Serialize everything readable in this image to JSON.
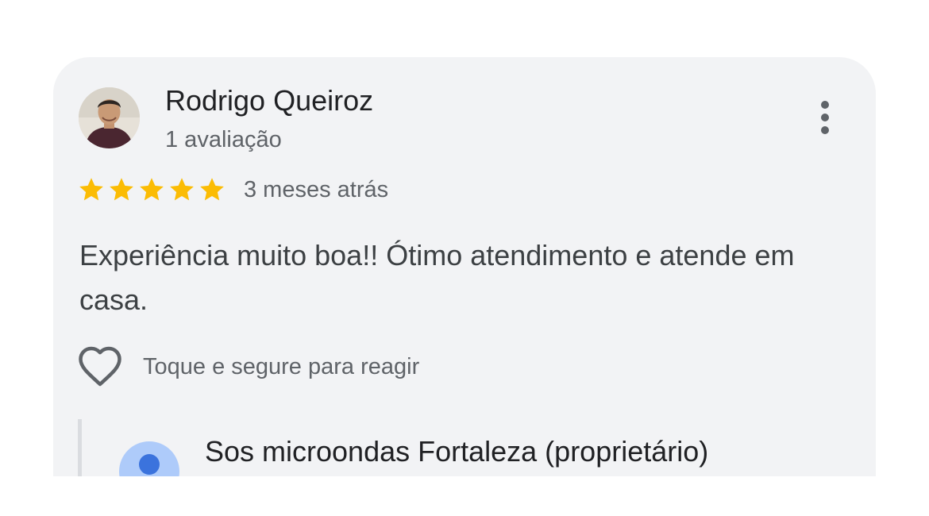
{
  "review": {
    "author_name": "Rodrigo Queiroz",
    "author_reviews": "1 avaliação",
    "rating": 5,
    "rating_max": 5,
    "star_color": "#fbbc04",
    "time": "3 meses atrás",
    "text": "Experiência muito boa!! Ótimo atendimento e atende em casa.",
    "react_hint": "Toque e segure para reagir"
  },
  "owner_reply": {
    "name": "Sos microondas Fortaleza (proprietário)"
  },
  "icons": {
    "more": "more-vert-icon",
    "heart": "heart-outline-icon",
    "star": "star-icon"
  }
}
